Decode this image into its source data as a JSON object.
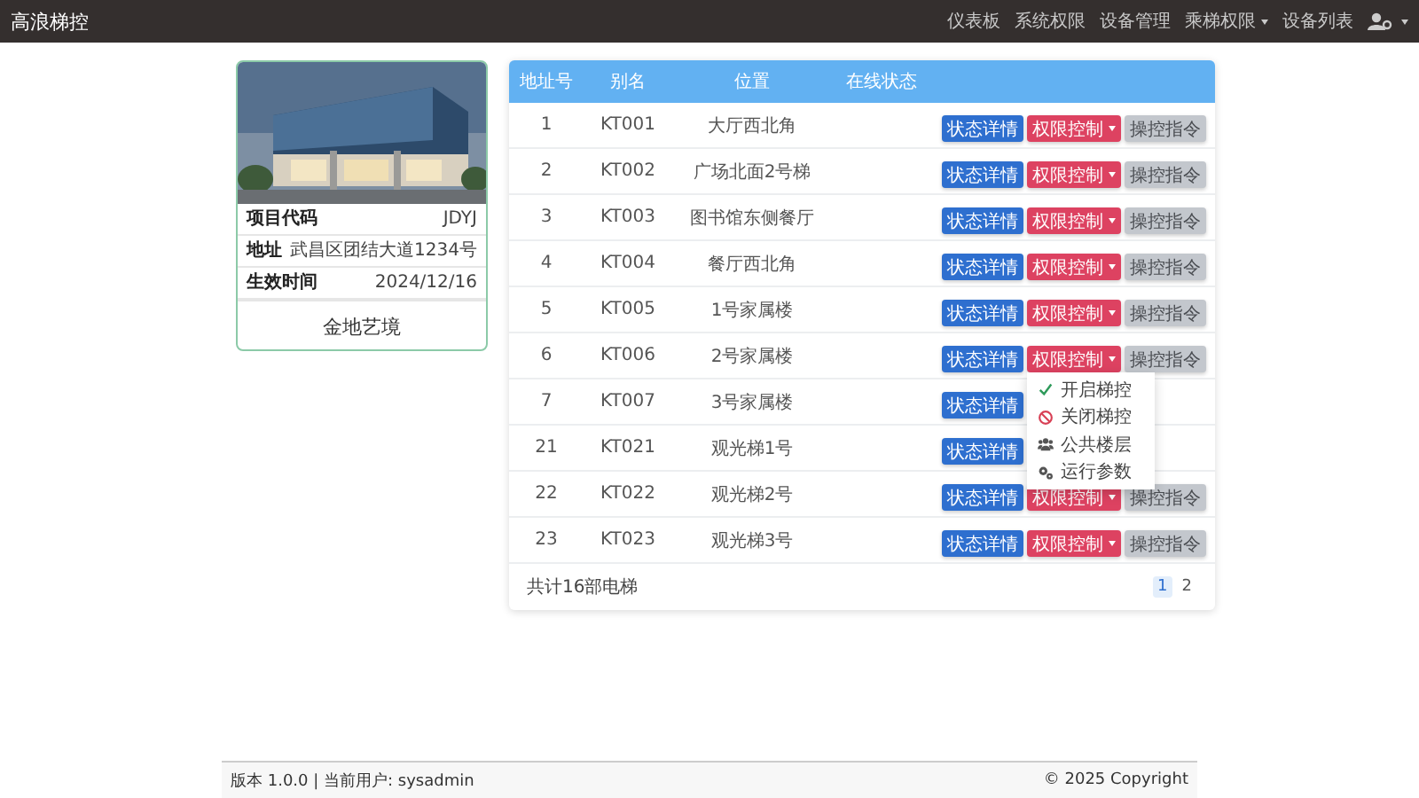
{
  "navbar": {
    "brand": "高浪梯控",
    "items": [
      {
        "label": "仪表板",
        "dropdown": false
      },
      {
        "label": "系统权限",
        "dropdown": false
      },
      {
        "label": "设备管理",
        "dropdown": false
      },
      {
        "label": "乘梯权限",
        "dropdown": true
      },
      {
        "label": "设备列表",
        "dropdown": false
      }
    ]
  },
  "project": {
    "fields": [
      {
        "label": "项目代码",
        "value": "JDYJ"
      },
      {
        "label": "地址",
        "value": "武昌区团结大道1234号"
      },
      {
        "label": "生效时间",
        "value": "2024/12/16"
      }
    ],
    "name": "金地艺境"
  },
  "table": {
    "columns": [
      "地址号",
      "别名",
      "位置",
      "在线状态"
    ],
    "rows": [
      {
        "address": "1",
        "alias": "KT001",
        "location": "大厅西北角",
        "buttons": [
          {
            "label": "状态详情",
            "kind": "detail"
          },
          {
            "label": "权限控制",
            "kind": "permission"
          },
          {
            "label": "操控指令",
            "kind": "command"
          }
        ]
      },
      {
        "address": "2",
        "alias": "KT002",
        "location": "广场北面2号梯",
        "buttons": [
          {
            "label": "状态详情",
            "kind": "detail"
          },
          {
            "label": "权限控制",
            "kind": "permission"
          },
          {
            "label": "操控指令",
            "kind": "command"
          }
        ]
      },
      {
        "address": "3",
        "alias": "KT003",
        "location": "图书馆东侧餐厅",
        "buttons": [
          {
            "label": "状态详情",
            "kind": "detail"
          },
          {
            "label": "权限控制",
            "kind": "permission"
          },
          {
            "label": "操控指令",
            "kind": "command"
          }
        ]
      },
      {
        "address": "4",
        "alias": "KT004",
        "location": "餐厅西北角",
        "buttons": [
          {
            "label": "状态详情",
            "kind": "detail"
          },
          {
            "label": "权限控制",
            "kind": "permission"
          },
          {
            "label": "操控指令",
            "kind": "command"
          }
        ]
      },
      {
        "address": "5",
        "alias": "KT005",
        "location": "1号家属楼",
        "buttons": [
          {
            "label": "状态详情",
            "kind": "detail"
          },
          {
            "label": "权限控制",
            "kind": "permission"
          },
          {
            "label": "操控指令",
            "kind": "command"
          }
        ]
      },
      {
        "address": "6",
        "alias": "KT006",
        "location": "2号家属楼",
        "buttons": [
          {
            "label": "状态详情",
            "kind": "detail"
          },
          {
            "label": "权限控制",
            "kind": "permission"
          },
          {
            "label": "操控指令",
            "kind": "command"
          }
        ],
        "menu": [
          {
            "label": "开启梯控",
            "kind": "enable"
          },
          {
            "label": "关闭梯控",
            "kind": "disable"
          },
          {
            "label": "公共楼层",
            "kind": "public_floors"
          },
          {
            "label": "运行参数",
            "kind": "parameters"
          }
        ]
      },
      {
        "address": "7",
        "alias": "KT007",
        "location": "3号家属楼",
        "buttons": [
          {
            "label": "状态详情",
            "kind": "detail"
          }
        ]
      },
      {
        "address": "21",
        "alias": "KT021",
        "location": "观光梯1号",
        "buttons": [
          {
            "label": "状态详情",
            "kind": "detail"
          }
        ]
      },
      {
        "address": "22",
        "alias": "KT022",
        "location": "观光梯2号",
        "buttons": [
          {
            "label": "状态详情",
            "kind": "detail"
          },
          {
            "label": "权限控制",
            "kind": "permission"
          },
          {
            "label": "操控指令",
            "kind": "command"
          }
        ]
      },
      {
        "address": "23",
        "alias": "KT023",
        "location": "观光梯3号",
        "buttons": [
          {
            "label": "状态详情",
            "kind": "detail"
          },
          {
            "label": "权限控制",
            "kind": "permission"
          },
          {
            "label": "操控指令",
            "kind": "command"
          }
        ]
      }
    ],
    "total": "共计16部电梯",
    "pages": [
      {
        "label": "1",
        "selected": true
      },
      {
        "label": "2",
        "selected": false
      }
    ]
  },
  "footer": {
    "version": "版本 1.0.0 | 当前用户: sysadmin",
    "copyright": "© 2025 Copyright"
  }
}
